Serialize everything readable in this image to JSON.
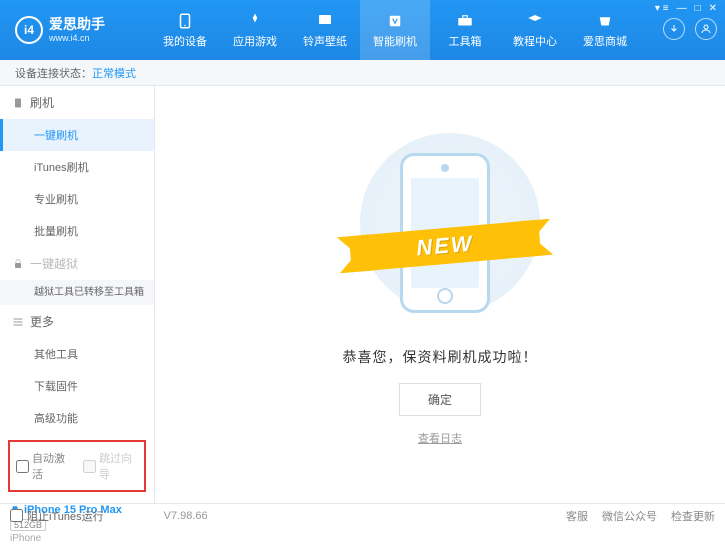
{
  "header": {
    "app_name": "爱思助手",
    "url": "www.i4.cn",
    "nav": [
      {
        "label": "我的设备"
      },
      {
        "label": "应用游戏"
      },
      {
        "label": "铃声壁纸"
      },
      {
        "label": "智能刷机"
      },
      {
        "label": "工具箱"
      },
      {
        "label": "教程中心"
      },
      {
        "label": "爱思商城"
      }
    ]
  },
  "subheader": {
    "label": "设备连接状态：",
    "mode": "正常模式"
  },
  "sidebar": {
    "sections": {
      "flash": {
        "title": "刷机",
        "items": [
          "一键刷机",
          "iTunes刷机",
          "专业刷机",
          "批量刷机"
        ]
      },
      "jailbreak": {
        "title": "一键越狱",
        "note": "越狱工具已转移至工具箱"
      },
      "more": {
        "title": "更多",
        "items": [
          "其他工具",
          "下载固件",
          "高级功能"
        ]
      }
    },
    "checks": {
      "auto_activate": "自动激活",
      "skip_guide": "跳过向导"
    },
    "device": {
      "name": "iPhone 15 Pro Max",
      "storage": "512GB",
      "type": "iPhone"
    }
  },
  "main": {
    "ribbon": "NEW",
    "message": "恭喜您，保资料刷机成功啦！",
    "confirm": "确定",
    "log_link": "查看日志"
  },
  "footer": {
    "block_itunes": "阻止iTunes运行",
    "version": "V7.98.66",
    "links": [
      "客服",
      "微信公众号",
      "检查更新"
    ]
  }
}
